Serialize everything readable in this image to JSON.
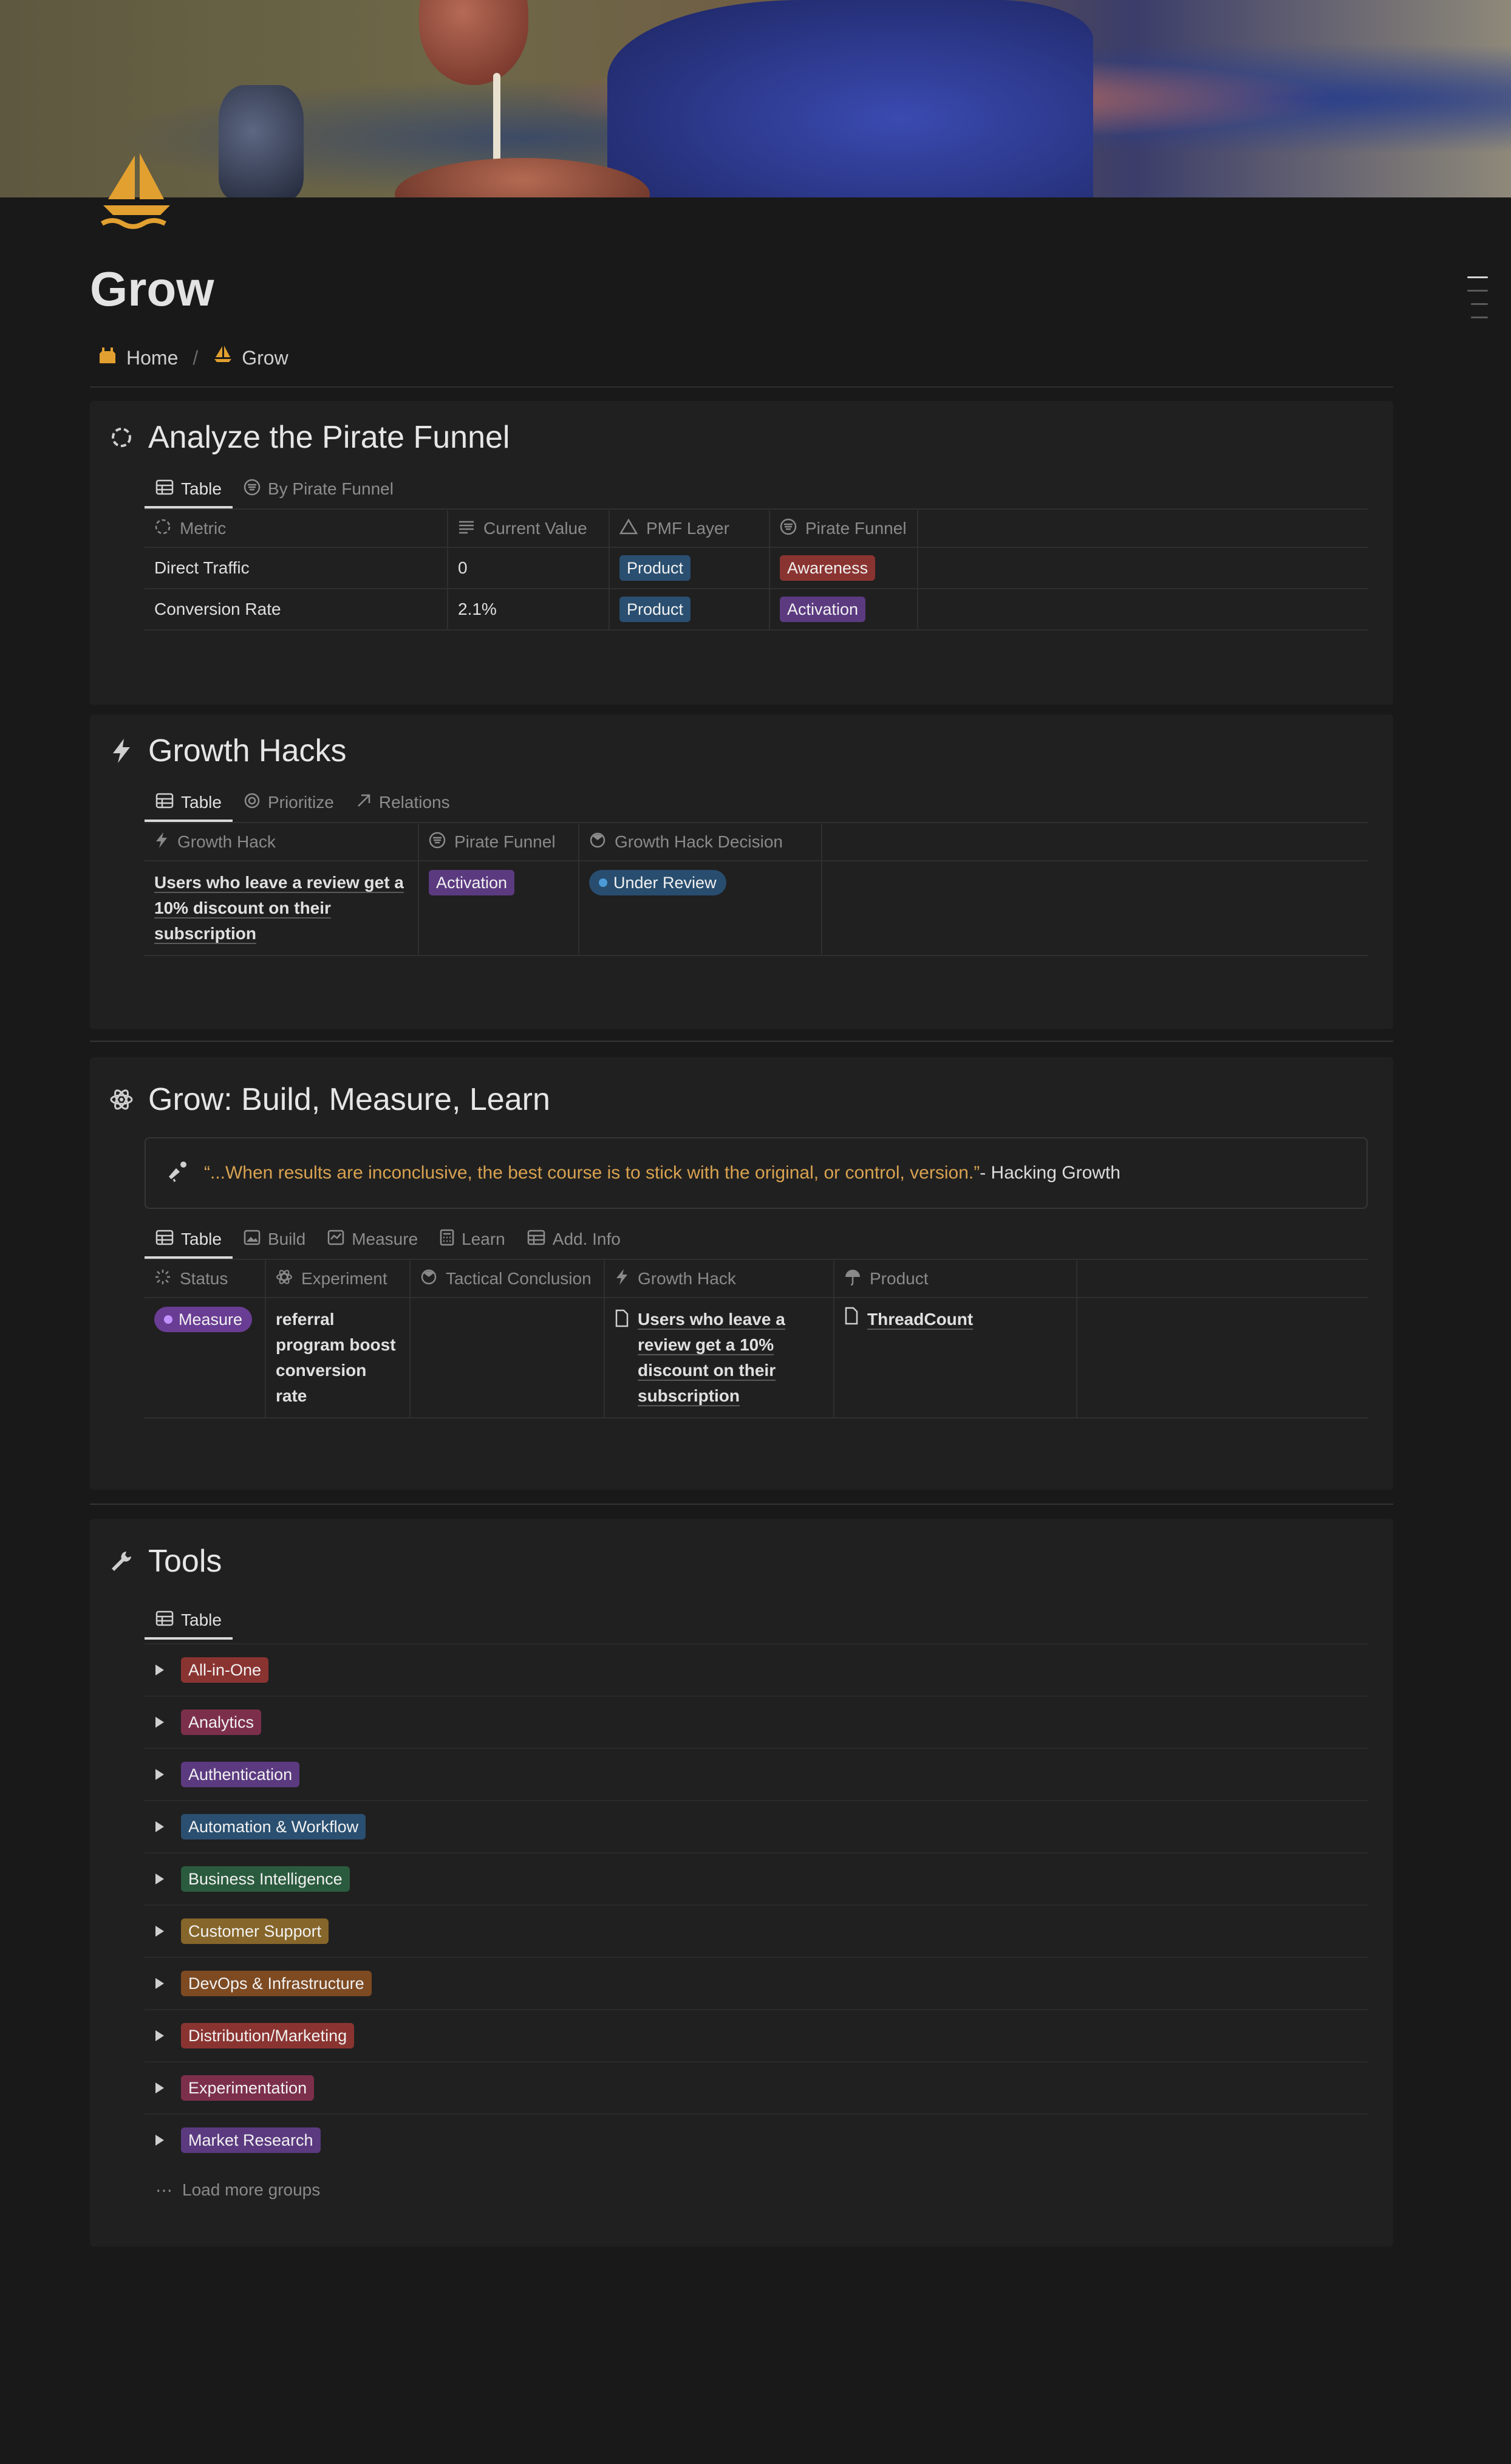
{
  "page": {
    "title": "Grow",
    "breadcrumb": [
      {
        "label": "Home",
        "icon": "castle-icon"
      },
      {
        "label": "Grow",
        "icon": "sailboat-icon"
      }
    ],
    "accent": "#e0a030"
  },
  "funnel": {
    "title": "Analyze the Pirate Funnel",
    "tabs": [
      "Table",
      "By Pirate Funnel"
    ],
    "columns": [
      "Metric",
      "Current Value",
      "PMF Layer",
      "Pirate Funnel"
    ],
    "rows": [
      {
        "metric": "Direct Traffic",
        "value": "0",
        "pmf": "Product",
        "funnel": "Awareness"
      },
      {
        "metric": "Conversion Rate",
        "value": "2.1%",
        "pmf": "Product",
        "funnel": "Activation"
      }
    ]
  },
  "hacks": {
    "title": "Growth Hacks",
    "tabs": [
      "Table",
      "Prioritize",
      "Relations"
    ],
    "columns": [
      "Growth Hack",
      "Pirate Funnel",
      "Growth Hack Decision"
    ],
    "rows": [
      {
        "hack": "Users who leave a review get a 10% discount on their subscription",
        "funnel": "Activation",
        "decision": "Under Review"
      }
    ]
  },
  "bml": {
    "title": "Grow: Build, Measure, Learn",
    "quote": "“...When results are inconclusive, the best course is to stick with the original, or control, version.”",
    "quote_source": " - Hacking Growth",
    "tabs": [
      "Table",
      "Build",
      "Measure",
      "Learn",
      "Add. Info"
    ],
    "columns": [
      "Status",
      "Experiment",
      "Tactical Conclusion",
      "Growth Hack",
      "Product"
    ],
    "rows": [
      {
        "status": "Measure",
        "experiment": "referral program boost conversion rate",
        "conclusion": "",
        "hack": "Users who leave a review get a 10% discount on their subscription",
        "product": "ThreadCount"
      }
    ]
  },
  "tools": {
    "title": "Tools",
    "tabs": [
      "Table"
    ],
    "groups": [
      {
        "label": "All-in-One",
        "color": "red"
      },
      {
        "label": "Analytics",
        "color": "pink"
      },
      {
        "label": "Authentication",
        "color": "purple"
      },
      {
        "label": "Automation & Workflow",
        "color": "blue"
      },
      {
        "label": "Business Intelligence",
        "color": "green"
      },
      {
        "label": "Customer Support",
        "color": "yellow"
      },
      {
        "label": "DevOps & Infrastructure",
        "color": "orange"
      },
      {
        "label": "Distribution/Marketing",
        "color": "red"
      },
      {
        "label": "Experimentation",
        "color": "pink"
      },
      {
        "label": "Market Research",
        "color": "purple"
      }
    ],
    "load_more": "Load more groups"
  }
}
